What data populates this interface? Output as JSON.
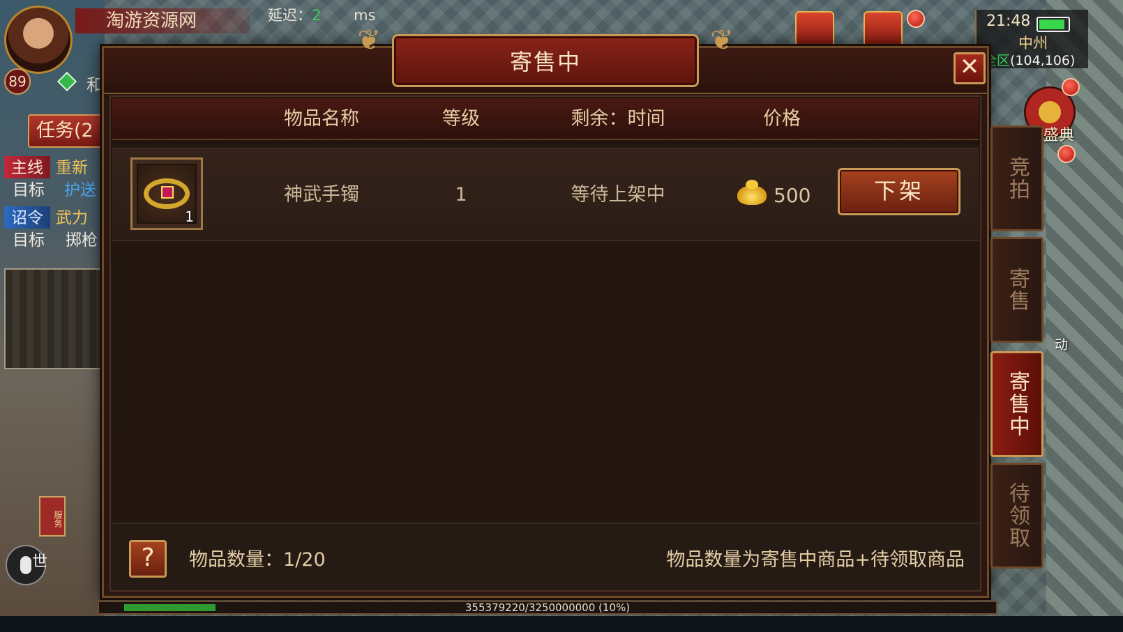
{
  "hud": {
    "site_name": "淘游资源网",
    "latency_label": "延迟：",
    "latency_value": "2",
    "latency_unit": "ms",
    "player_level": "89",
    "gem_text": "和",
    "task_button": "任务(2",
    "tasks": [
      {
        "tag": "主线",
        "title": "重新"
      },
      {
        "label": "目标",
        "detail": "护送"
      },
      {
        "tag": "诏令",
        "title": "武力"
      },
      {
        "label": "目标",
        "detail": "掷枪"
      }
    ],
    "world_chat": "世",
    "scroll_tag": "服务",
    "clock": "21:48",
    "battery_level": 0.9,
    "map_name": "中州",
    "zone": "全区",
    "coords": "(104,106)",
    "festival_label": "盛典",
    "activity_label": "动"
  },
  "dialog": {
    "title": "寄售中",
    "close_icon": "close-icon",
    "columns": [
      "物品名称",
      "等级",
      "剩余：时间",
      "价格"
    ],
    "rows": [
      {
        "icon": "bracelet-icon",
        "count": "1",
        "name": "神武手镯",
        "level": "1",
        "time": "等待上架中",
        "price_icon": "gold-ingot-icon",
        "price": "500",
        "action": "下架"
      }
    ],
    "help_button": "?",
    "count_label": "物品数量：1/20",
    "note": "物品数量为寄售中商品+待领取商品"
  },
  "side_tabs": [
    {
      "label": "竞拍",
      "active": false
    },
    {
      "label": "寄售",
      "active": false
    },
    {
      "label": "寄售中",
      "active": true
    },
    {
      "label": "待领取",
      "active": false
    }
  ],
  "exp": {
    "text": "355379220/3250000000 (10%)",
    "fraction": 0.1093
  },
  "colors": {
    "accent_gold": "#c99a54",
    "panel_dark": "#2a1712",
    "active_tab": "#8a1c12",
    "latency_green": "#3ed05a"
  }
}
